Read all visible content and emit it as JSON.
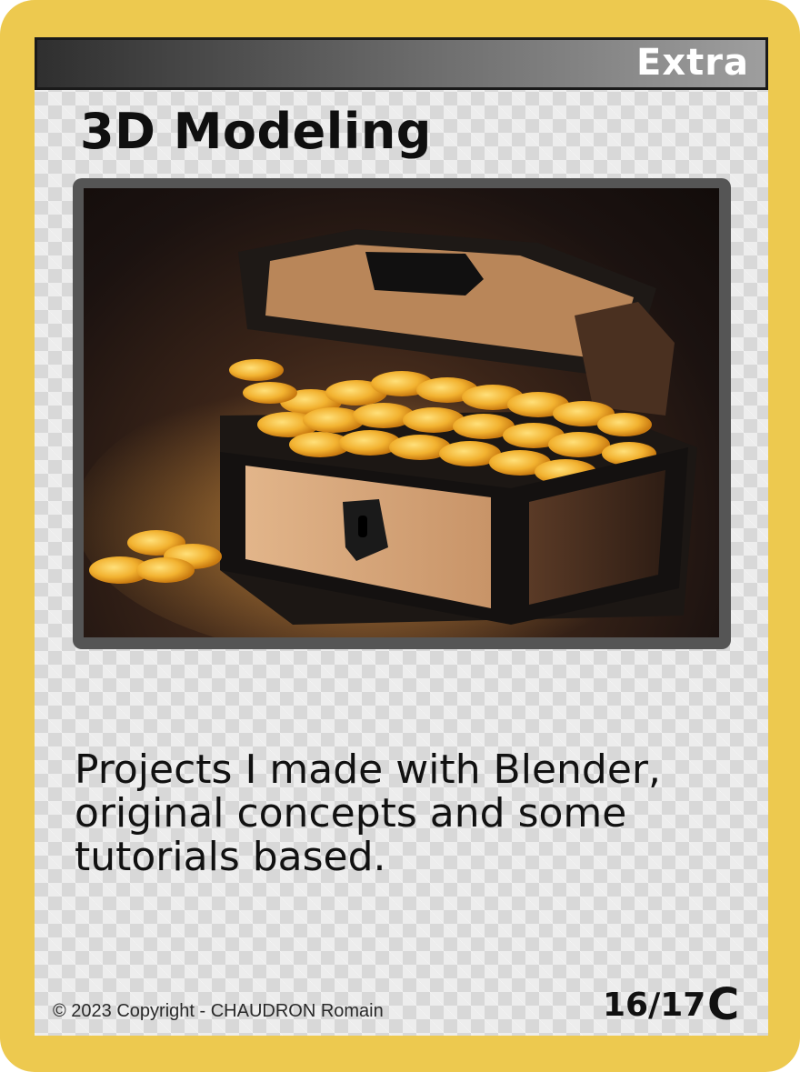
{
  "card": {
    "type_label": "Extra",
    "title": "3D Modeling",
    "description": "Projects I made with Blender, original concepts and some tutorials based.",
    "copyright": "© 2023 Copyright - CHAUDRON Romain",
    "number": "16/17",
    "rarity_symbol": "C",
    "image_subject": "treasure-chest-with-gold-coins-render"
  },
  "colors": {
    "border": "#edc94f",
    "panel": "#d8d8d8",
    "header_dark": "#2f2f2f",
    "header_light": "#9e9e9e",
    "frame": "#555555",
    "text": "#111111",
    "coin_gold": "#f2b230"
  }
}
